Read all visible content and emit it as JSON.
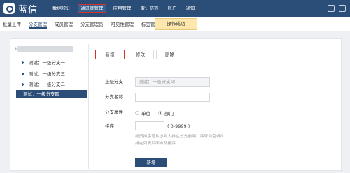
{
  "header": {
    "app_name": "蓝信",
    "nav": [
      {
        "label": "数据统计"
      },
      {
        "label": "通讯录管理"
      },
      {
        "label": "应用管理"
      },
      {
        "label": "审计防范"
      },
      {
        "label": "账户"
      },
      {
        "label": "通知"
      }
    ]
  },
  "subnav": [
    {
      "label": "批量上传"
    },
    {
      "label": "分支管理"
    },
    {
      "label": "成员管理"
    },
    {
      "label": "分支管理员"
    },
    {
      "label": "可见性管理"
    },
    {
      "label": "标签管理"
    }
  ],
  "toast": "操作成功",
  "tree": {
    "items": [
      {
        "label": "测试：一级分支一"
      },
      {
        "label": "测试：一级分支三"
      },
      {
        "label": "测试：一级分支二"
      },
      {
        "label": "测试：一级分支四"
      }
    ]
  },
  "tabs": [
    {
      "label": "新增"
    },
    {
      "label": "修改"
    },
    {
      "label": "删除"
    }
  ],
  "form": {
    "parent_label": "上级分支",
    "parent_value": "测试：一级分支四",
    "name_label": "分支名称",
    "attr_label": "分支属性",
    "attr_options": [
      {
        "label": "单位"
      },
      {
        "label": "部门"
      }
    ],
    "attr_selected": "部门",
    "order_label": "排序",
    "order_range": "( 0-9999 )",
    "hint_line1": "成员排序号从小到大排在分支前端；序号为空或0",
    "hint_line2": "排在列表后面自然排序",
    "submit_label": "新增"
  }
}
